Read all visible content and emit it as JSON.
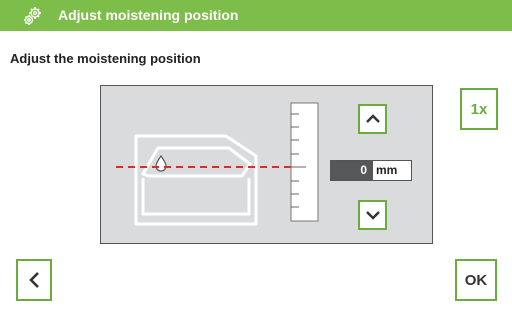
{
  "header": {
    "title": "Adjust moistening position",
    "icon": "gear-icon"
  },
  "subtitle": "Adjust the moistening position",
  "controls": {
    "repeat_label": "1x",
    "ok_label": "OK",
    "position_value": "0",
    "position_unit": "mm"
  },
  "colors": {
    "header_green": "#7cbe49",
    "accent_green": "#6cac3c",
    "guide_red": "#d0312d",
    "panel_gray": "#dadbdd"
  }
}
